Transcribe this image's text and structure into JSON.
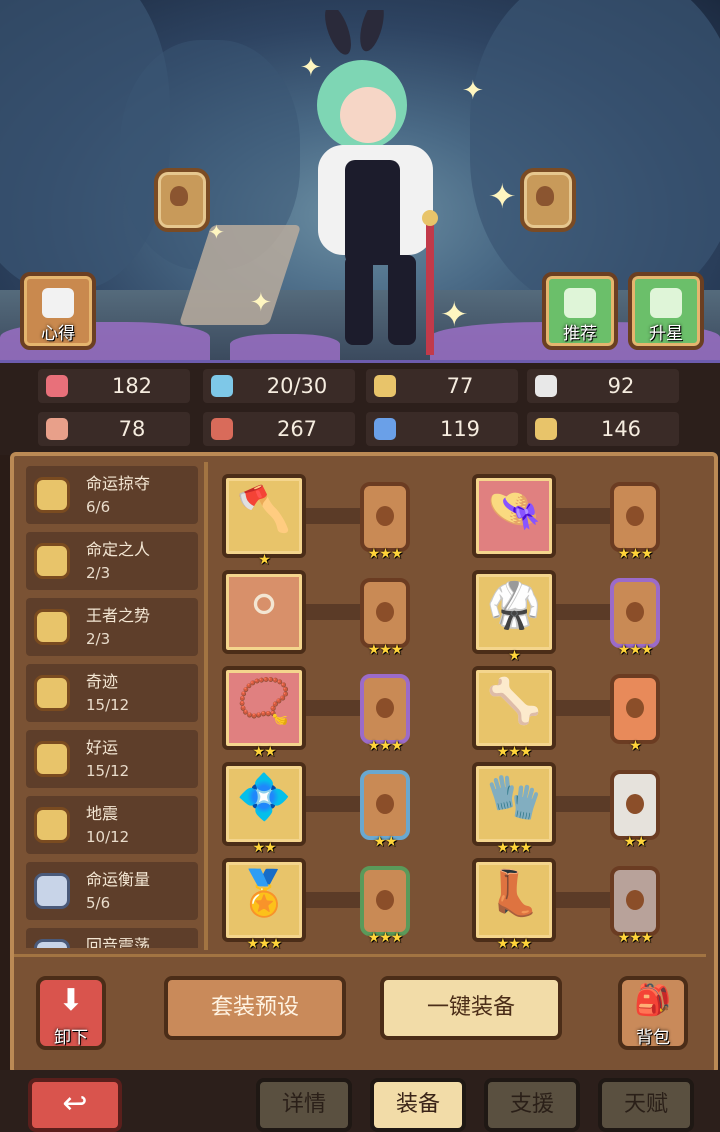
{
  "scene": {
    "buttons": {
      "experience": "心得",
      "recommend": "推荐",
      "star_up": "升星"
    }
  },
  "stats": [
    {
      "icon": "heart-icon",
      "value": "182",
      "color": "#e8707a"
    },
    {
      "icon": "droplet-icon",
      "value": "20/30",
      "color": "#7ec8e8"
    },
    {
      "icon": "shield-icon",
      "value": "77",
      "color": "#e8c46a"
    },
    {
      "icon": "wing-icon",
      "value": "92",
      "color": "#e8e8e8"
    },
    {
      "icon": "fist-icon",
      "value": "78",
      "color": "#e8a08a"
    },
    {
      "icon": "book-icon",
      "value": "267",
      "color": "#d96b5a"
    },
    {
      "icon": "scroll-icon",
      "value": "119",
      "color": "#6aa0e8"
    },
    {
      "icon": "horseshoe-icon",
      "value": "146",
      "color": "#e8c46a"
    }
  ],
  "sets": [
    {
      "name": "命运掠夺",
      "count": "6/6"
    },
    {
      "name": "命定之人",
      "count": "2/3"
    },
    {
      "name": "王者之势",
      "count": "2/3"
    },
    {
      "name": "奇迹",
      "count": "15/12"
    },
    {
      "name": "好运",
      "count": "15/12"
    },
    {
      "name": "地震",
      "count": "10/12"
    },
    {
      "name": "命运衡量",
      "count": "5/6"
    },
    {
      "name": "回音震荡",
      "count": ""
    }
  ],
  "equipment": [
    {
      "item": "axe-icon",
      "item_stars": "★",
      "rune_stars": "★★★",
      "item_bg": "#e8c46a",
      "rune_border": "#6b3c22"
    },
    {
      "item": "hat-icon",
      "item_stars": "",
      "rune_stars": "★★★",
      "item_bg": "#e08080",
      "rune_border": "#6b3c22"
    },
    {
      "item": "orb-icon",
      "item_stars": "",
      "rune_stars": "★★★",
      "item_bg": "#d8906a",
      "rune_border": "#6b3c22"
    },
    {
      "item": "armor-icon",
      "item_stars": "★",
      "rune_stars": "★★★",
      "item_bg": "#e8c46a",
      "rune_border": "#9b6bc9"
    },
    {
      "item": "necklace-icon",
      "item_stars": "★★",
      "rune_stars": "★★★",
      "item_bg": "#e08080",
      "rune_border": "#9b6bc9"
    },
    {
      "item": "bone-icon",
      "item_stars": "★★★",
      "rune_stars": "★",
      "item_bg": "#e8c46a",
      "rune_border": "#6b3c22"
    },
    {
      "item": "gem-plate-icon",
      "item_stars": "★★",
      "rune_stars": "★★",
      "item_bg": "#e8c46a",
      "rune_border": "#6aa8d0"
    },
    {
      "item": "bracer-icon",
      "item_stars": "★★★",
      "rune_stars": "★★",
      "item_bg": "#e8c46a",
      "rune_border": "#6b3c22"
    },
    {
      "item": "belt-icon",
      "item_stars": "★★★",
      "rune_stars": "★★★",
      "item_bg": "#e8c46a",
      "rune_border": "#5a9a5a"
    },
    {
      "item": "boots-icon",
      "item_stars": "★★★",
      "rune_stars": "★★★",
      "item_bg": "#e8c46a",
      "rune_border": "#6b3c22"
    }
  ],
  "actions": {
    "unequip": "卸下",
    "preset": "套装预设",
    "equip_all": "一键装备",
    "backpack": "背包"
  },
  "tabs": [
    "详情",
    "装备",
    "支援",
    "天赋"
  ],
  "active_tab": "装备"
}
